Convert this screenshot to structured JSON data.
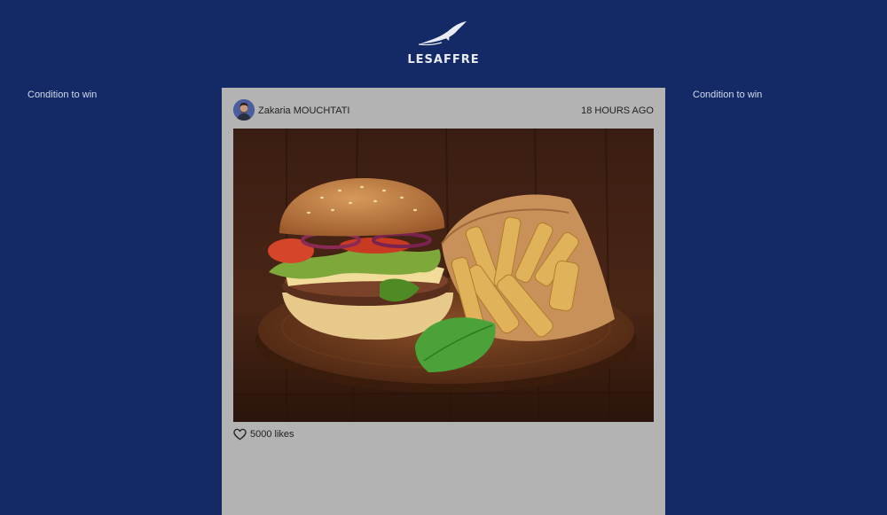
{
  "brand": {
    "name": "LESAFFRE",
    "logo_icon": "swallow-bird-icon"
  },
  "sidebar": {
    "left_label": "Condition to win",
    "right_label": "Condition to win"
  },
  "post": {
    "author": "Zakaria MOUCHTATI",
    "time_ago": "18 HOURS AGO",
    "likes_label": "5000 likes",
    "image_subject": "burger-and-fries-photo",
    "like_icon": "heart-icon"
  },
  "colors": {
    "background": "#142a66",
    "card": "#b3b3b3",
    "text": "#222222",
    "side_text": "#d5dbee"
  }
}
